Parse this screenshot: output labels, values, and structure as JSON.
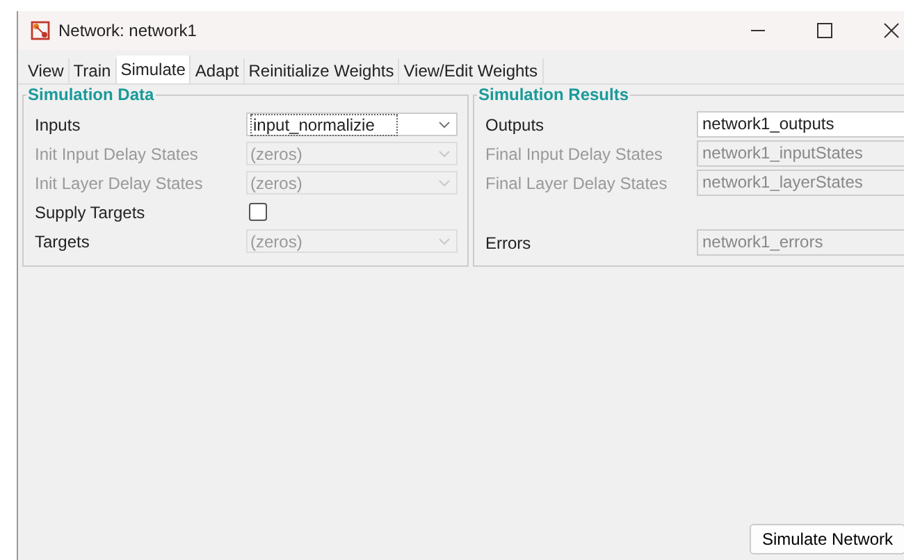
{
  "window": {
    "title": "Network: network1"
  },
  "tabs": [
    {
      "label": "View",
      "selected": false
    },
    {
      "label": "Train",
      "selected": false
    },
    {
      "label": "Simulate",
      "selected": true
    },
    {
      "label": "Adapt",
      "selected": false
    },
    {
      "label": "Reinitialize Weights",
      "selected": false
    },
    {
      "label": "View/Edit Weights",
      "selected": false
    }
  ],
  "simulation_data": {
    "title": "Simulation Data",
    "rows": [
      {
        "kind": "combo",
        "label": "Inputs",
        "value": "input_normalizie",
        "label_disabled": false,
        "disabled": false
      },
      {
        "kind": "combo",
        "label": "Init Input Delay States",
        "value": "(zeros)",
        "label_disabled": true,
        "disabled": true
      },
      {
        "kind": "combo",
        "label": "Init Layer Delay States",
        "value": "(zeros)",
        "label_disabled": true,
        "disabled": true
      },
      {
        "kind": "checkbox",
        "label": "Supply Targets",
        "checked": false,
        "label_disabled": false
      },
      {
        "kind": "combo",
        "label": "Targets",
        "value": "(zeros)",
        "label_disabled": false,
        "disabled": true
      }
    ]
  },
  "simulation_results": {
    "title": "Simulation Results",
    "rows": [
      {
        "label": "Outputs",
        "value": "network1_outputs",
        "label_disabled": false,
        "disabled": false
      },
      {
        "label": "Final Input Delay States",
        "value": "network1_inputStates",
        "label_disabled": true,
        "disabled": true
      },
      {
        "label": "Final Layer Delay States",
        "value": "network1_layerStates",
        "label_disabled": true,
        "disabled": true
      },
      {
        "label": "Errors",
        "value": "network1_errors",
        "label_disabled": false,
        "disabled": true
      }
    ]
  },
  "buttons": [
    "Simulate Network"
  ]
}
